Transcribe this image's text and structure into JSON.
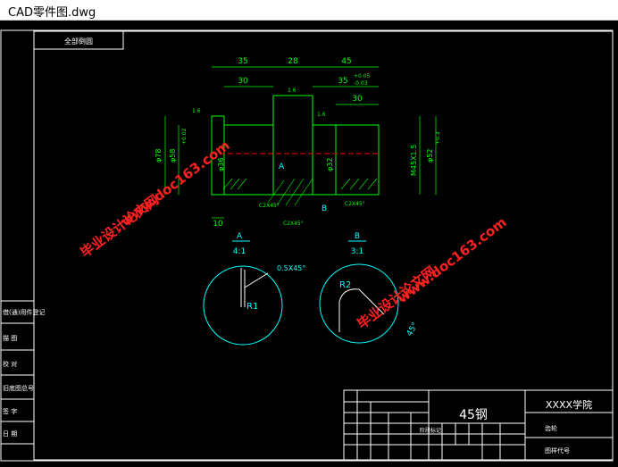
{
  "window": {
    "title": "CAD零件图.dwg"
  },
  "drawing": {
    "top_label": "全部倒圆",
    "dims": {
      "d35_left": "35",
      "d30_left": "30",
      "d28": "28",
      "d45": "45",
      "d35_tol": "35",
      "tol_up": "+0.05",
      "tol_dn": "-0.03",
      "d30_right": "30",
      "d10": "10",
      "phi78": "φ78",
      "phi58": "φ58",
      "phi36": "φ36",
      "phi32": "φ32",
      "phi52": "φ52",
      "m45": "M45X1.5",
      "phi_tol_left": "+0.02",
      "phi_tol_right": "+0.3",
      "rough": "1.6",
      "c2x45_a": "C2X45°",
      "c2x45_b": "C2X45°",
      "c2x45_c": "C2X45°",
      "sec_a": "A",
      "sec_b": "B"
    },
    "detail_a": {
      "label": "A",
      "scale": "4:1",
      "chamfer": "0.5X45°",
      "radius": "R1"
    },
    "detail_b": {
      "label": "B",
      "scale": "3:1",
      "radius": "R2",
      "angle": "45°"
    },
    "watermarks": [
      "毕业设计论文网",
      "www.doc163.com",
      "毕业设计论文网",
      "www.doc163.com"
    ],
    "left_panel": [
      "装配图号",
      "借(通)用件登记",
      "描 图",
      "校 对",
      "旧底图总号",
      "签 字",
      "日 期"
    ],
    "title_block": {
      "material": "45钢",
      "company": "XXXX学院",
      "part_name": "齿轮",
      "drawing_no": "图样代号",
      "stage": "阶段标记"
    }
  },
  "colors": {
    "frame": "#ffffff",
    "green": "#00ff00",
    "cyan": "#00ffff",
    "red": "#ff0000",
    "watermark": "#ff2020"
  }
}
